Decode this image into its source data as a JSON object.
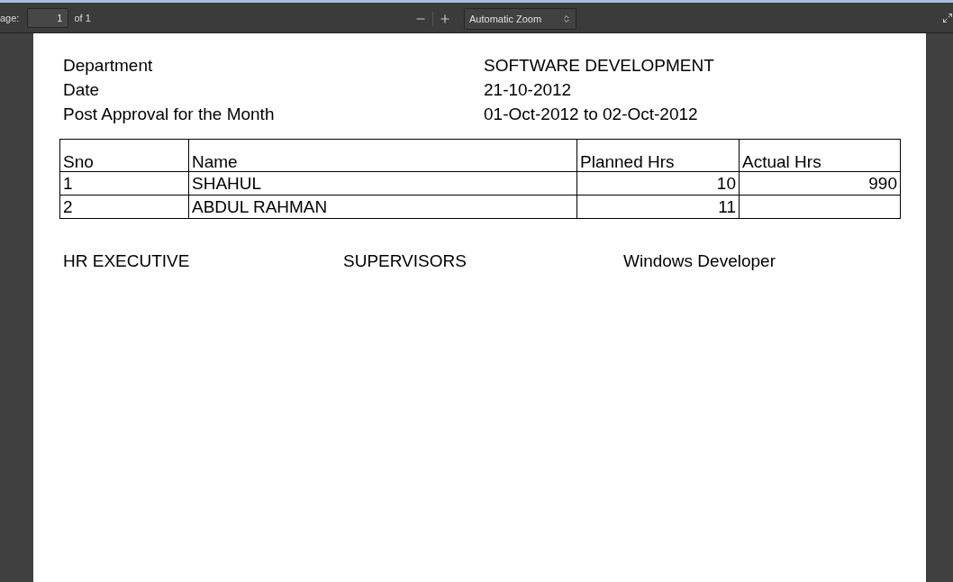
{
  "toolbar": {
    "page_label": "age:",
    "page_number": "1",
    "page_count": "of 1",
    "zoom": "Automatic Zoom"
  },
  "document": {
    "info": [
      {
        "label": "Department",
        "value": "SOFTWARE DEVELOPMENT"
      },
      {
        "label": "Date",
        "value": "21-10-2012"
      },
      {
        "label": "Post Approval for the Month",
        "value": "01-Oct-2012 to 02-Oct-2012"
      }
    ],
    "table": {
      "columns": [
        "Sno",
        "Name",
        "Planned Hrs",
        "Actual Hrs"
      ],
      "rows": [
        [
          "1",
          "SHAHUL",
          "10",
          "990"
        ],
        [
          "2",
          "ABDUL RAHMAN",
          "11",
          ""
        ]
      ]
    },
    "signatures": [
      "HR EXECUTIVE",
      "SUPERVISORS",
      "Windows Developer"
    ]
  }
}
